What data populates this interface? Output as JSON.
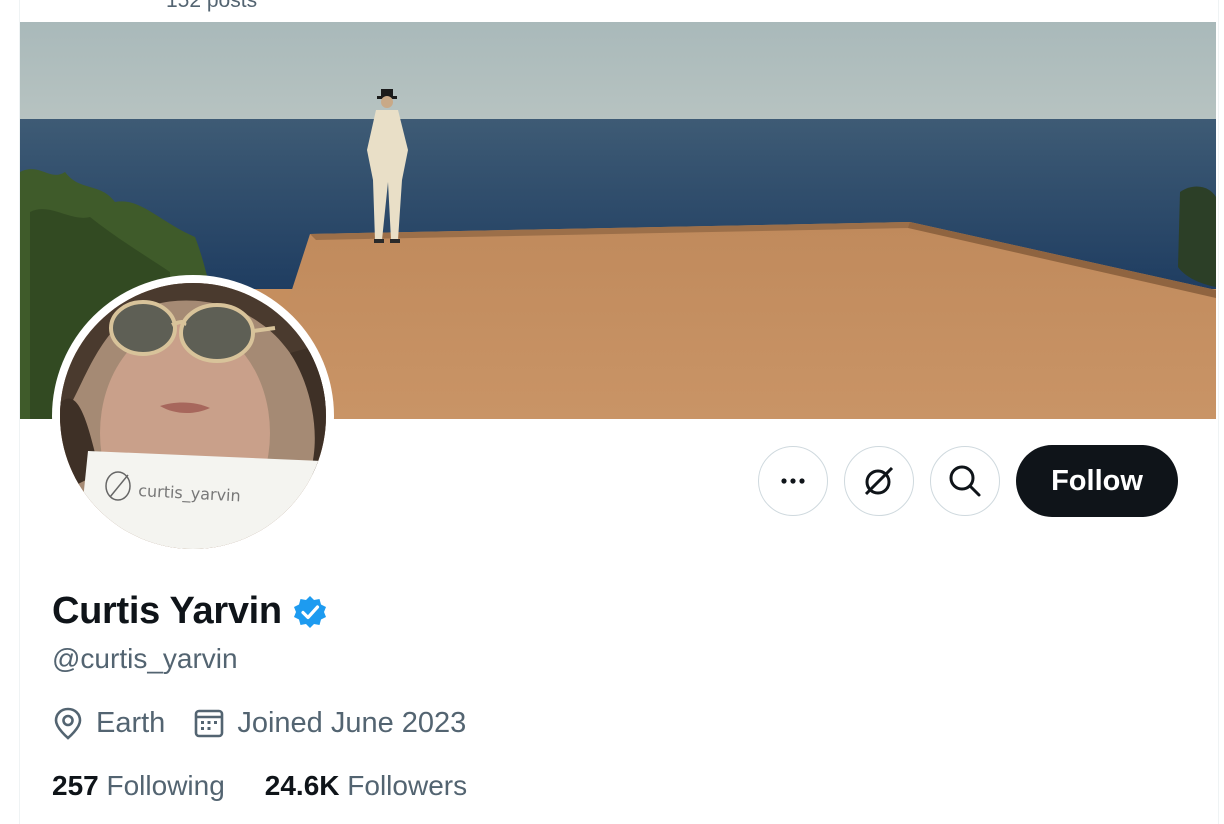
{
  "header": {
    "posts_count": "152 posts"
  },
  "profile": {
    "display_name": "Curtis Yarvin",
    "handle": "@curtis_yarvin",
    "verified": true,
    "location": "Earth",
    "joined": "Joined June 2023",
    "following_count": "257",
    "following_label": "Following",
    "followers_count": "24.6K",
    "followers_label": "Followers",
    "avatar_sign_text": "curtis_yarvin"
  },
  "actions": {
    "more_icon": "more-icon",
    "grok_icon": "grok-icon",
    "search_icon": "search-icon",
    "follow_label": "Follow"
  },
  "colors": {
    "follow_bg": "#0f1419",
    "secondary_text": "#536471",
    "verified_blue": "#1d9bf0"
  }
}
